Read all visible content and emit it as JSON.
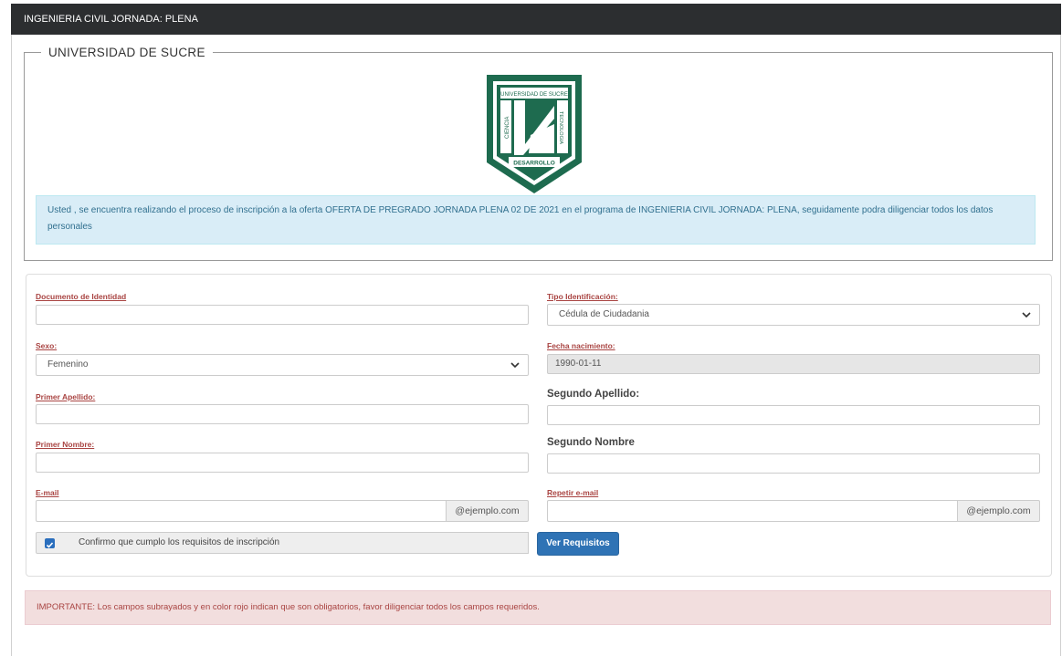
{
  "header": {
    "title": "INGENIERIA CIVIL JORNADA: PLENA"
  },
  "university": {
    "legend": "UNIVERSIDAD DE SUCRE",
    "logo": {
      "top_text": "UNIVERSIDAD DE SUCRE",
      "left_text": "CIENCIA",
      "right_text": "TECNOLOGIA",
      "bottom_text": "DESARROLLO",
      "color": "#1e6b4f"
    },
    "info_message": "Usted , se encuentra realizando el proceso de inscripción a la oferta OFERTA DE PREGRADO JORNADA PLENA 02 DE 2021 en el programa de INGENIERIA CIVIL JORNADA: PLENA, seguidamente podra diligenciar todos los datos personales"
  },
  "form": {
    "documento": {
      "label": "Documento de Identidad",
      "value": ""
    },
    "tipo_identificacion": {
      "label": "Tipo Identificación:",
      "value": "Cédula de Ciudadania"
    },
    "sexo": {
      "label": "Sexo:",
      "value": "Femenino"
    },
    "fecha_nacimiento": {
      "label": "Fecha nacimiento:",
      "value": "1990-01-11"
    },
    "primer_apellido": {
      "label": "Primer Apellido:",
      "value": ""
    },
    "segundo_apellido": {
      "label": "Segundo Apellido:",
      "value": ""
    },
    "primer_nombre": {
      "label": "Primer Nombre:",
      "value": ""
    },
    "segundo_nombre": {
      "label": "Segundo Nombre",
      "value": ""
    },
    "email": {
      "label": "E-mail",
      "value": "",
      "addon": "@ejemplo.com"
    },
    "repetir_email": {
      "label": "Repetir e-mail",
      "value": "",
      "addon": "@ejemplo.com"
    },
    "confirm": {
      "text": "Confirmo que cumplo los requisitos de inscripción",
      "checked": true
    },
    "ver_requisitos": "Ver Requisitos"
  },
  "important_message": "IMPORTANTE: Los campos subrayados y en color rojo indican que son obligatorios, favor diligenciar todos los campos requeridos."
}
